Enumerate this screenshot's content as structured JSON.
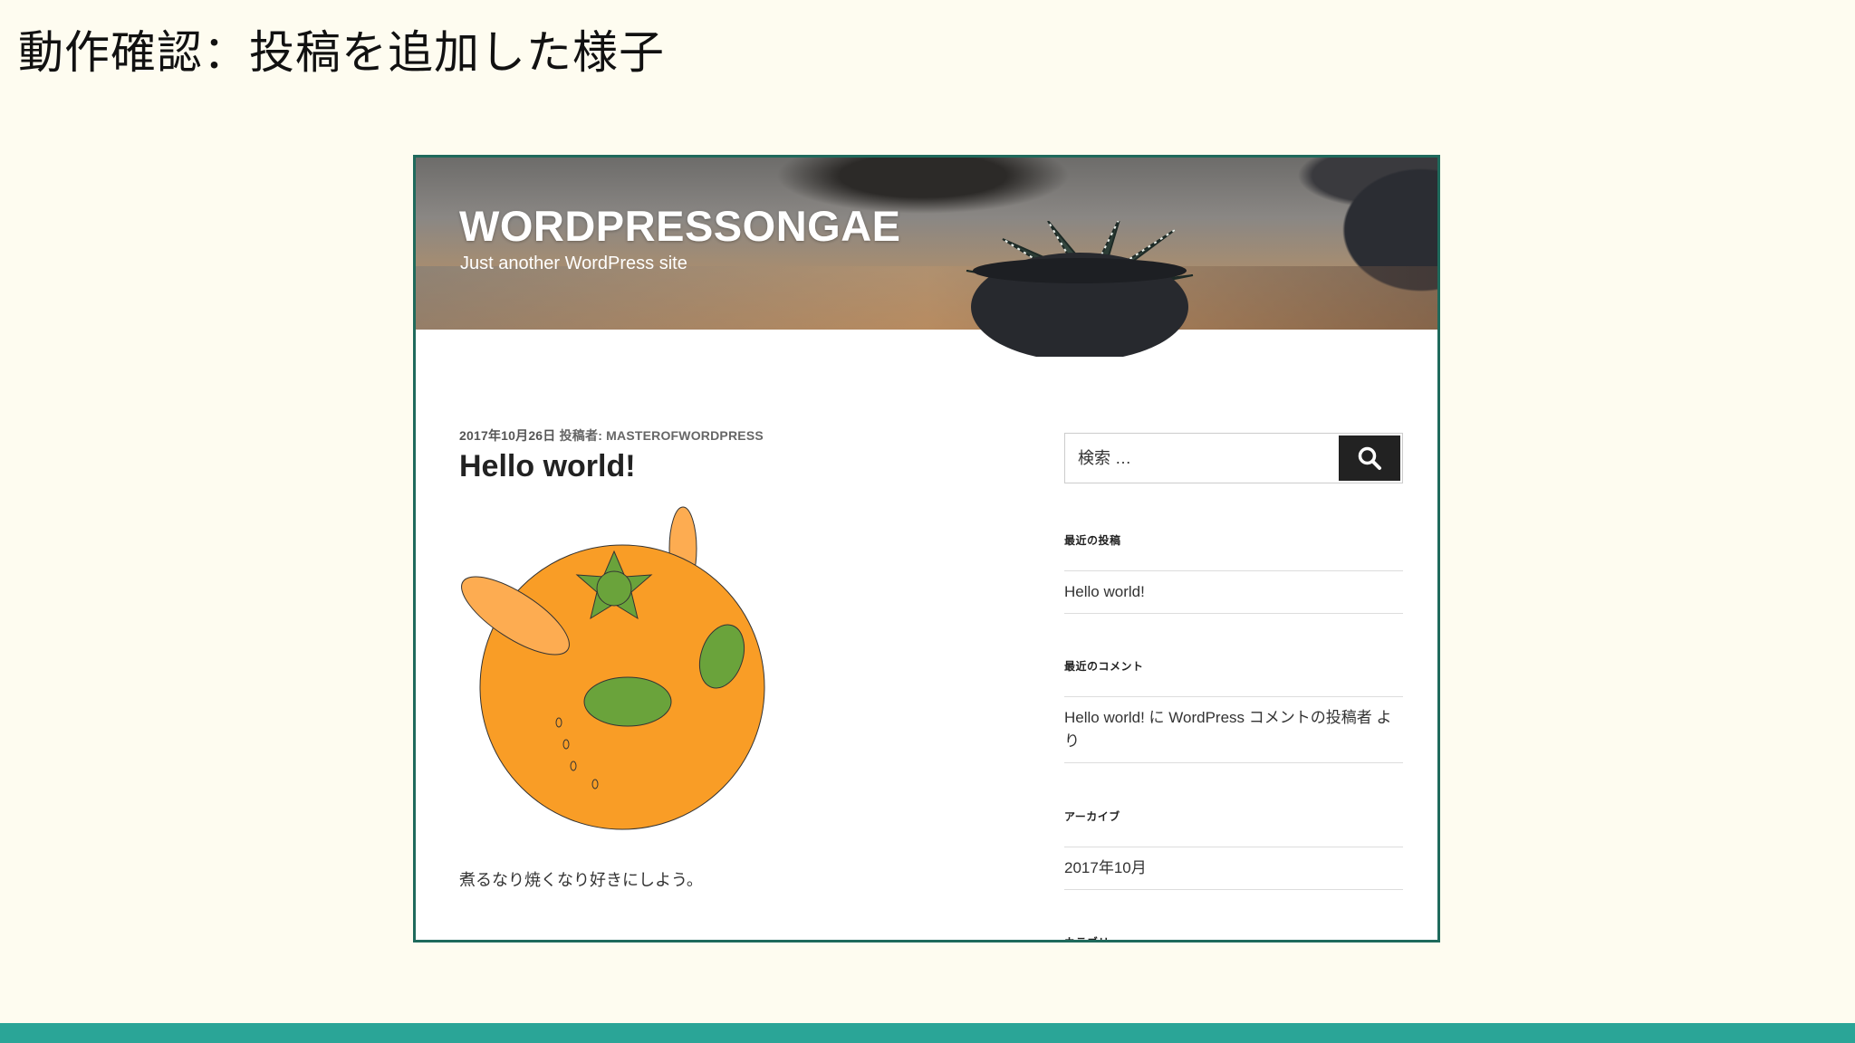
{
  "slide": {
    "title": "動作確認：投稿を追加した様子"
  },
  "site": {
    "title": "WORDPRESSONGAE",
    "description": "Just another WordPress site"
  },
  "post": {
    "date": "2017年10月26日",
    "author_label": "投稿者:",
    "author": "MASTEROFWORDPRESS",
    "title": "Hello world!",
    "body": "煮るなり焼くなり好きにしよう。"
  },
  "sidebar": {
    "search_placeholder": "検索 …",
    "recent_posts_title": "最近の投稿",
    "recent_posts": [
      "Hello world!"
    ],
    "recent_comments_title": "最近のコメント",
    "recent_comment": "Hello world! に WordPress コメントの投稿者 より",
    "archives_title": "アーカイブ",
    "archives": [
      "2017年10月"
    ],
    "categories_title": "カテゴリー"
  },
  "colors": {
    "accent_bar": "#2aa597",
    "frame_border": "#1f6a5c",
    "orange": "#f99d26",
    "green": "#6aa33b"
  }
}
